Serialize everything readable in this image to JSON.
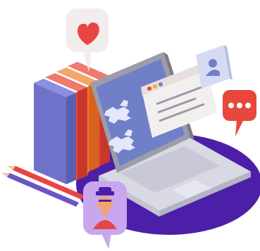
{
  "scene": {
    "description_icons": [
      "heart-icon",
      "user-profile-icon",
      "chat-dots-icon",
      "heraldic-lions-icon",
      "guard-avatar-icon"
    ],
    "colors": {
      "purple": "#4B1FA8",
      "laptop_body": "#D9D9E3",
      "laptop_screen_frame": "#8E8E9C",
      "screen_blue": "#6F7FC8",
      "book_blue": "#6E73C9",
      "book_red": "#E8473B",
      "book_orange": "#F07A2C",
      "heart_red": "#E84545",
      "bubble_bg": "#F3ECEC",
      "chat_red": "#E8473B",
      "pencil_red": "#E84545",
      "pencil_purple": "#6D55C8",
      "avatar_bg": "#C8A7EE",
      "avatar_face": "#F2A46F"
    }
  }
}
